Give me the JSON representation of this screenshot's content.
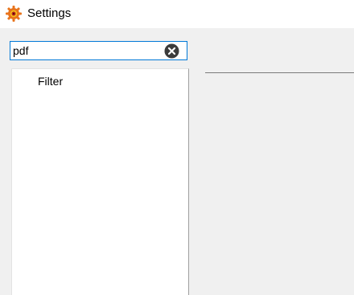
{
  "window": {
    "title": "Settings",
    "icon": "settings-app-icon"
  },
  "search": {
    "value": "pdf",
    "clear_icon": "clear-circle-x-icon",
    "focus_color": "#0078d7"
  },
  "tree": {
    "items": [
      {
        "label": "Filter"
      }
    ]
  }
}
